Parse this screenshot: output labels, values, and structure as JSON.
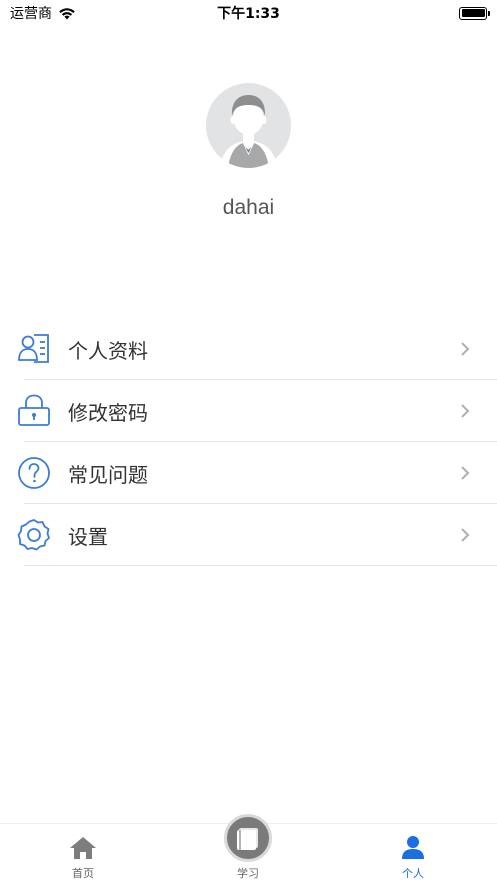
{
  "status_bar": {
    "carrier": "运营商",
    "time": "下午1:33",
    "battery_level": 1.0
  },
  "profile": {
    "username": "dahai"
  },
  "menu": {
    "items": [
      {
        "label": "个人资料",
        "icon": "profile-card-icon"
      },
      {
        "label": "修改密码",
        "icon": "lock-icon"
      },
      {
        "label": "常见问题",
        "icon": "question-icon"
      },
      {
        "label": "设置",
        "icon": "gear-icon"
      }
    ]
  },
  "tab_bar": {
    "tabs": [
      {
        "label": "首页",
        "icon": "home-icon",
        "active": false
      },
      {
        "label": "学习",
        "icon": "book-icon",
        "active": false
      },
      {
        "label": "个人",
        "icon": "person-icon",
        "active": true
      }
    ]
  },
  "colors": {
    "accent": "#1a6ee0",
    "icon_blue": "#3b7bd9",
    "chevron": "#b0b0b0",
    "tab_inactive": "#666666"
  }
}
